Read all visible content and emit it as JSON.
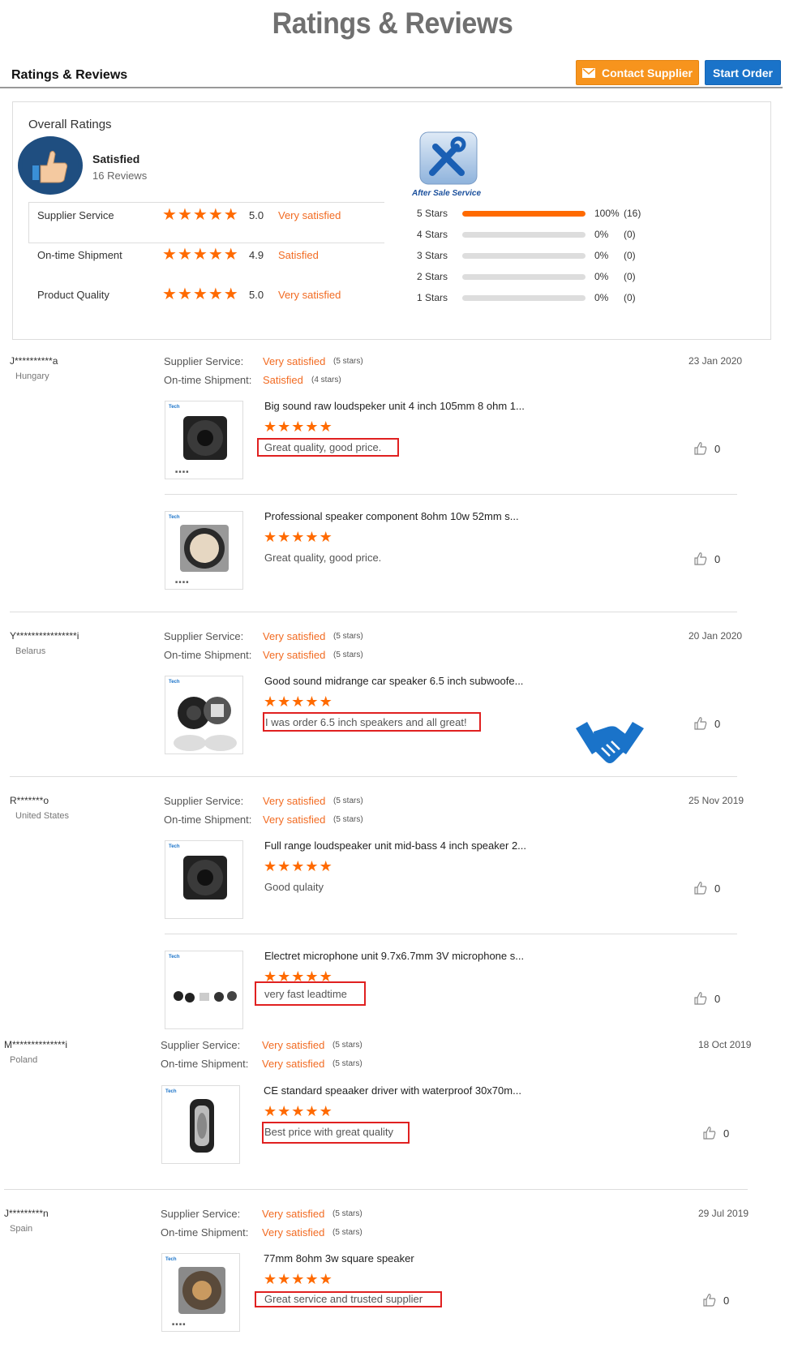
{
  "banner_title": "Ratings & Reviews",
  "header": {
    "title": "Ratings & Reviews",
    "contact_label": "Contact Supplier",
    "start_label": "Start Order"
  },
  "overall": {
    "title": "Overall Ratings",
    "status": "Satisfied",
    "reviews": "16 Reviews",
    "rows": [
      {
        "label": "Supplier Service",
        "score": "5.0",
        "text": "Very satisfied"
      },
      {
        "label": "On-time Shipment",
        "score": "4.9",
        "text": "Satisfied"
      },
      {
        "label": "Product Quality",
        "score": "5.0",
        "text": "Very satisfied"
      }
    ],
    "after_sale_label": "After Sale Service",
    "distribution": [
      {
        "label": "5 Stars",
        "pct": "100%",
        "count": "(16)",
        "fraction": 1.0
      },
      {
        "label": "4 Stars",
        "pct": "0%",
        "count": "(0)",
        "fraction": 0
      },
      {
        "label": "3 Stars",
        "pct": "0%",
        "count": "(0)",
        "fraction": 0
      },
      {
        "label": "2 Stars",
        "pct": "0%",
        "count": "(0)",
        "fraction": 0
      },
      {
        "label": "1 Stars",
        "pct": "0%",
        "count": "(0)",
        "fraction": 0
      }
    ]
  },
  "labels": {
    "supplier_service": "Supplier Service:",
    "ontime_shipment": "On-time Shipment:"
  },
  "brand_mini": "Tech",
  "reviews": [
    {
      "user": "J**********a",
      "country": "Hungary",
      "date": "23 Jan 2020",
      "service_text": "Very satisfied",
      "service_stars": "(5 stars)",
      "shipment_text": "Satisfied",
      "shipment_stars": "(4 stars)",
      "products": [
        {
          "title": "Big sound raw loudspeker unit 4 inch 105mm 8 ohm 1...",
          "comment": "Great quality, good price.",
          "likes": "0"
        },
        {
          "title": "Professional speaker component 8ohm 10w 52mm s...",
          "comment": "Great quality, good price.",
          "likes": "0"
        }
      ]
    },
    {
      "user": "Y****************i",
      "country": "Belarus",
      "date": "20 Jan 2020",
      "service_text": "Very satisfied",
      "service_stars": "(5 stars)",
      "shipment_text": "Very satisfied",
      "shipment_stars": "(5 stars)",
      "products": [
        {
          "title": "Good sound midrange car speaker 6.5 inch subwoofe...",
          "comment": "I was order 6.5 inch speakers and all great!",
          "likes": "0"
        }
      ]
    },
    {
      "user": "R*******o",
      "country": "United States",
      "date": "25 Nov 2019",
      "service_text": "Very satisfied",
      "service_stars": "(5 stars)",
      "shipment_text": "Very satisfied",
      "shipment_stars": "(5 stars)",
      "products": [
        {
          "title": "Full range loudspeaker unit mid-bass 4 inch speaker 2...",
          "comment": "Good qulaity",
          "likes": "0"
        },
        {
          "title": "Electret microphone unit 9.7x6.7mm 3V microphone s...",
          "comment": "very fast leadtime",
          "likes": "0"
        }
      ]
    },
    {
      "user": "M**************i",
      "country": "Poland",
      "date": "18 Oct 2019",
      "service_text": "Very satisfied",
      "service_stars": "(5 stars)",
      "shipment_text": "Very satisfied",
      "shipment_stars": "(5 stars)",
      "products": [
        {
          "title": "CE standard speaaker driver with waterproof 30x70m...",
          "comment": "Best price with great quality",
          "likes": "0"
        }
      ]
    },
    {
      "user": "J*********n",
      "country": "Spain",
      "date": "29 Jul 2019",
      "service_text": "Very satisfied",
      "service_stars": "(5 stars)",
      "shipment_text": "Very satisfied",
      "shipment_stars": "(5 stars)",
      "products": [
        {
          "title": "77mm 8ohm 3w square speaker",
          "comment": "Great service and trusted supplier",
          "likes": "0"
        }
      ]
    }
  ],
  "colors": {
    "accent_orange": "#ff6a00",
    "button_blue": "#1a73c9",
    "highlight_red": "#e02020",
    "icon_blue": "#1a73c9"
  }
}
